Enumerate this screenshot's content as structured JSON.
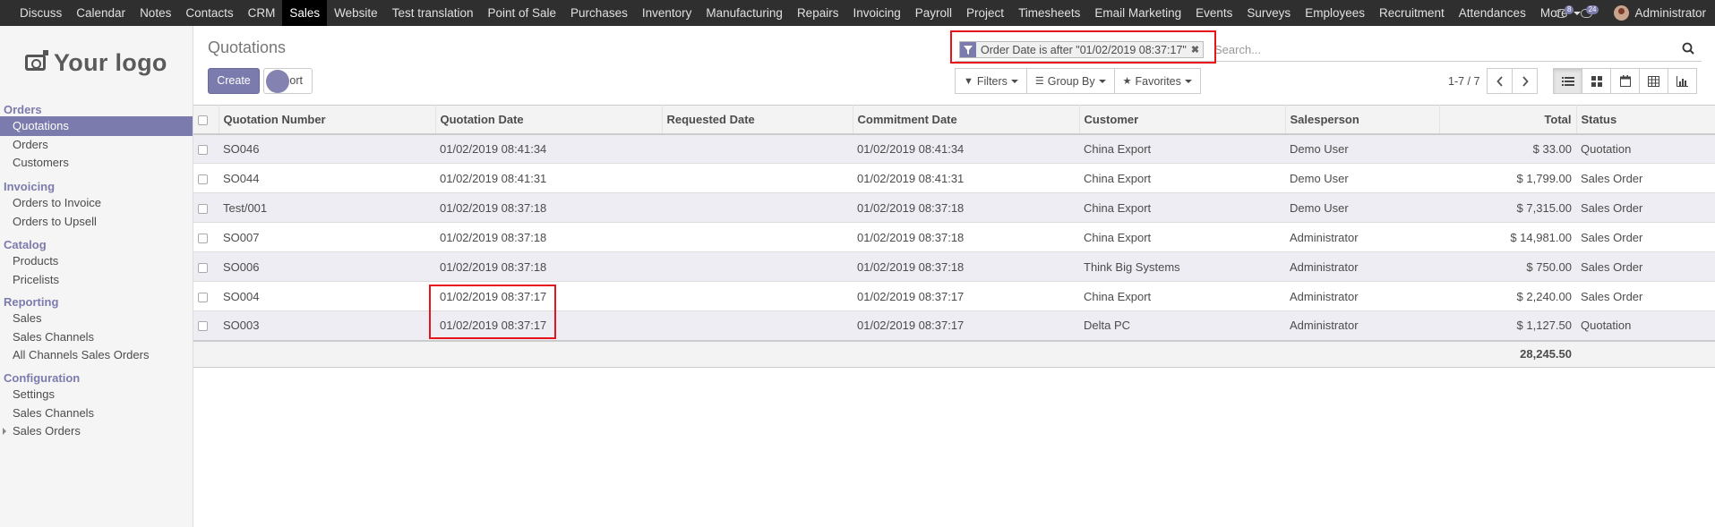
{
  "topnav": {
    "items": [
      "Discuss",
      "Calendar",
      "Notes",
      "Contacts",
      "CRM",
      "Sales",
      "Website",
      "Test translation",
      "Point of Sale",
      "Purchases",
      "Inventory",
      "Manufacturing",
      "Repairs",
      "Invoicing",
      "Payroll",
      "Project",
      "Timesheets",
      "Email Marketing",
      "Events",
      "Surveys",
      "Employees",
      "Recruitment",
      "Attendances"
    ],
    "active": "Sales",
    "more_label": "More",
    "activity_count": "8",
    "messages_count": "24",
    "user_name": "Administrator"
  },
  "sidebar": {
    "logo_text": "Your logo",
    "sections": [
      {
        "title": "Orders",
        "items": [
          "Quotations",
          "Orders",
          "Customers"
        ]
      },
      {
        "title": "Invoicing",
        "items": [
          "Orders to Invoice",
          "Orders to Upsell"
        ]
      },
      {
        "title": "Catalog",
        "items": [
          "Products",
          "Pricelists"
        ]
      },
      {
        "title": "Reporting",
        "items": [
          "Sales",
          "Sales Channels",
          "All Channels Sales Orders"
        ]
      },
      {
        "title": "Configuration",
        "items": [
          "Settings",
          "Sales Channels",
          "Sales Orders"
        ]
      }
    ],
    "active_item": "Quotations"
  },
  "control_panel": {
    "breadcrumb": "Quotations",
    "create_label": "Create",
    "import_label": "Import",
    "import_visible_label": "ort",
    "search": {
      "facet": "Order Date is after \"01/02/2019 08:37:17\"",
      "facet_remove": "✖",
      "placeholder": "Search..."
    },
    "filters_label": "Filters",
    "groupby_label": "Group By",
    "favorites_label": "Favorites",
    "pager": "1-7 / 7"
  },
  "table": {
    "columns": [
      "Quotation Number",
      "Quotation Date",
      "Requested Date",
      "Commitment Date",
      "Customer",
      "Salesperson",
      "Total",
      "Status"
    ],
    "rows": [
      {
        "number": "SO046",
        "date": "01/02/2019 08:41:34",
        "requested": "",
        "commitment": "01/02/2019 08:41:34",
        "customer": "China Export",
        "salesperson": "Demo User",
        "total": "$ 33.00",
        "status": "Quotation"
      },
      {
        "number": "SO044",
        "date": "01/02/2019 08:41:31",
        "requested": "",
        "commitment": "01/02/2019 08:41:31",
        "customer": "China Export",
        "salesperson": "Demo User",
        "total": "$ 1,799.00",
        "status": "Sales Order"
      },
      {
        "number": "Test/001",
        "date": "01/02/2019 08:37:18",
        "requested": "",
        "commitment": "01/02/2019 08:37:18",
        "customer": "China Export",
        "salesperson": "Demo User",
        "total": "$ 7,315.00",
        "status": "Sales Order"
      },
      {
        "number": "SO007",
        "date": "01/02/2019 08:37:18",
        "requested": "",
        "commitment": "01/02/2019 08:37:18",
        "customer": "China Export",
        "salesperson": "Administrator",
        "total": "$ 14,981.00",
        "status": "Sales Order"
      },
      {
        "number": "SO006",
        "date": "01/02/2019 08:37:18",
        "requested": "",
        "commitment": "01/02/2019 08:37:18",
        "customer": "Think Big Systems",
        "salesperson": "Administrator",
        "total": "$ 750.00",
        "status": "Sales Order"
      },
      {
        "number": "SO004",
        "date": "01/02/2019 08:37:17",
        "requested": "",
        "commitment": "01/02/2019 08:37:17",
        "customer": "China Export",
        "salesperson": "Administrator",
        "total": "$ 2,240.00",
        "status": "Sales Order"
      },
      {
        "number": "SO003",
        "date": "01/02/2019 08:37:17",
        "requested": "",
        "commitment": "01/02/2019 08:37:17",
        "customer": "Delta PC",
        "salesperson": "Administrator",
        "total": "$ 1,127.50",
        "status": "Quotation"
      }
    ],
    "footer_total": "28,245.50"
  },
  "colors": {
    "accent": "#7c7bad",
    "highlight": "#e8141c",
    "topbar": "#2f2f2f"
  }
}
